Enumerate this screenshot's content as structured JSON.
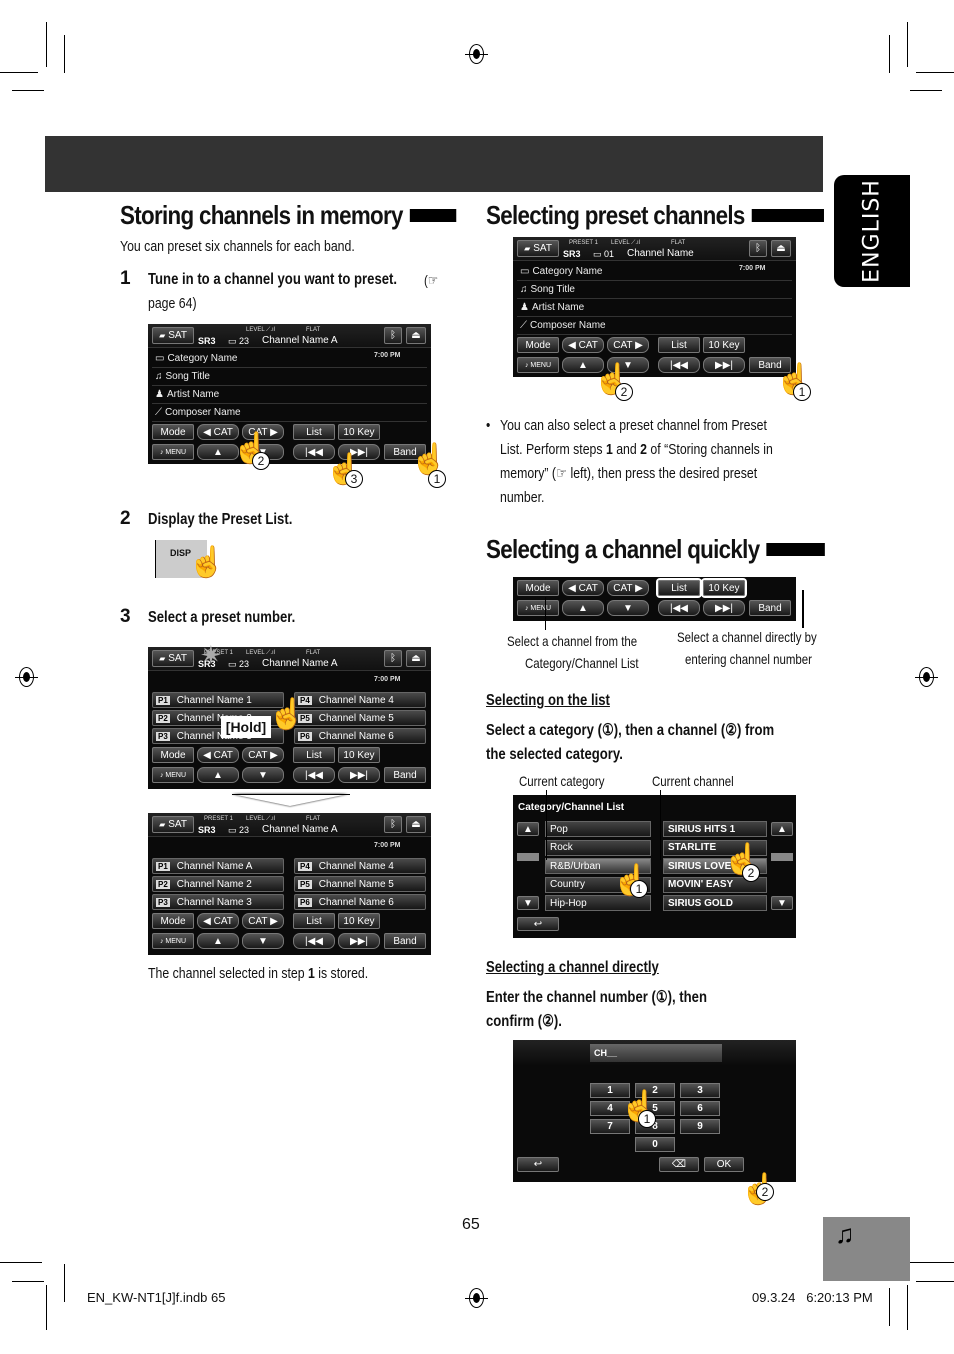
{
  "lang_tab": "ENGLISH",
  "left": {
    "title": "Storing channels in memory",
    "intro": "You can preset six channels for each band.",
    "step1": {
      "num": "1",
      "text": "Tune in to a channel you want to preset.",
      "ref": "(☞ page 64)"
    },
    "step2": {
      "num": "2",
      "text": "Display the Preset List.",
      "disp_label": "DISP"
    },
    "step3": {
      "num": "3",
      "text": "Select a preset number.",
      "hold_label": "[Hold]"
    },
    "stored_note_pre": "The channel selected in step ",
    "stored_note_num": "1",
    "stored_note_post": " is stored."
  },
  "screen_common": {
    "source": "SAT",
    "band": "SR3",
    "level": "LEVEL",
    "eq": "FLAT",
    "clock": "7:00 PM",
    "rows": [
      "Category Name",
      "Song Title",
      "Artist Name",
      "Composer Name"
    ],
    "buttons": {
      "mode": "Mode",
      "cat_prev": "◀ CAT",
      "cat_next": "CAT ▶",
      "list": "List",
      "tenkey": "10 Key",
      "menu": "MENU",
      "up": "▲",
      "down": "▼",
      "prev": "|◀◀",
      "next": "▶▶|",
      "band": "Band"
    }
  },
  "screen1": {
    "channel_num": "23",
    "channel_name": "Channel Name A"
  },
  "screen_preset_before": {
    "preset": "PRESET 1",
    "channel_num": "23",
    "channel_name": "Channel Name A",
    "presets": [
      {
        "tag": "P1",
        "name": "Channel Name 1"
      },
      {
        "tag": "P2",
        "name": "Channel Name 2"
      },
      {
        "tag": "P3",
        "name": "Channel Name 3"
      },
      {
        "tag": "P4",
        "name": "Channel Name 4"
      },
      {
        "tag": "P5",
        "name": "Channel Name 5"
      },
      {
        "tag": "P6",
        "name": "Channel Name 6"
      }
    ]
  },
  "screen_preset_after": {
    "preset": "PRESET 1",
    "channel_num": "23",
    "channel_name": "Channel Name A",
    "presets": [
      {
        "tag": "P1",
        "name": "Channel Name A"
      },
      {
        "tag": "P2",
        "name": "Channel Name 2"
      },
      {
        "tag": "P3",
        "name": "Channel Name 3"
      },
      {
        "tag": "P4",
        "name": "Channel Name 4"
      },
      {
        "tag": "P5",
        "name": "Channel Name 5"
      },
      {
        "tag": "P6",
        "name": "Channel Name 6"
      }
    ]
  },
  "right": {
    "title1": "Selecting preset channels",
    "screen": {
      "preset": "PRESET 1",
      "channel_num": "01",
      "channel_name": "Channel Name"
    },
    "bullet": [
      "You can also select a preset channel from Preset",
      "List. Perform steps 1 and 2 of “Storing channels in",
      "memory” (☞ left), then press the desired preset",
      "number."
    ],
    "title2": "Selecting a channel quickly",
    "callout_left": [
      "Select a channel from the",
      "Category/Channel List"
    ],
    "callout_right": [
      "Select a channel directly by",
      "entering channel number"
    ],
    "sub1": "Selecting on the list",
    "sub1_instr": [
      "Select a category (①), then a channel (②) from",
      "the selected category."
    ],
    "label_cur_cat": "Current category",
    "label_cur_ch": "Current channel",
    "list_title": "Category/Channel List",
    "categories": [
      "Pop",
      "Rock",
      "R&B/Urban",
      "Country",
      "Hip-Hop"
    ],
    "channels": [
      "SIRIUS HITS 1",
      "STARLITE",
      "SIRIUS LOVE",
      "MOVIN' EASY",
      "SIRIUS GOLD"
    ],
    "sub2": "Selecting a channel directly",
    "sub2_instr": [
      "Enter the channel number (①), then",
      "confirm (②)."
    ],
    "ch_field": "CH__",
    "keys": [
      "1",
      "2",
      "3",
      "4",
      "5",
      "6",
      "7",
      "8",
      "9",
      "0"
    ],
    "ok": "OK"
  },
  "markers": {
    "one": "1",
    "two": "2",
    "three": "3"
  },
  "footer": {
    "page": "65",
    "file": "EN_KW-NT1[J]f.indb   65",
    "date": "09.3.24   6:20:13 PM"
  }
}
